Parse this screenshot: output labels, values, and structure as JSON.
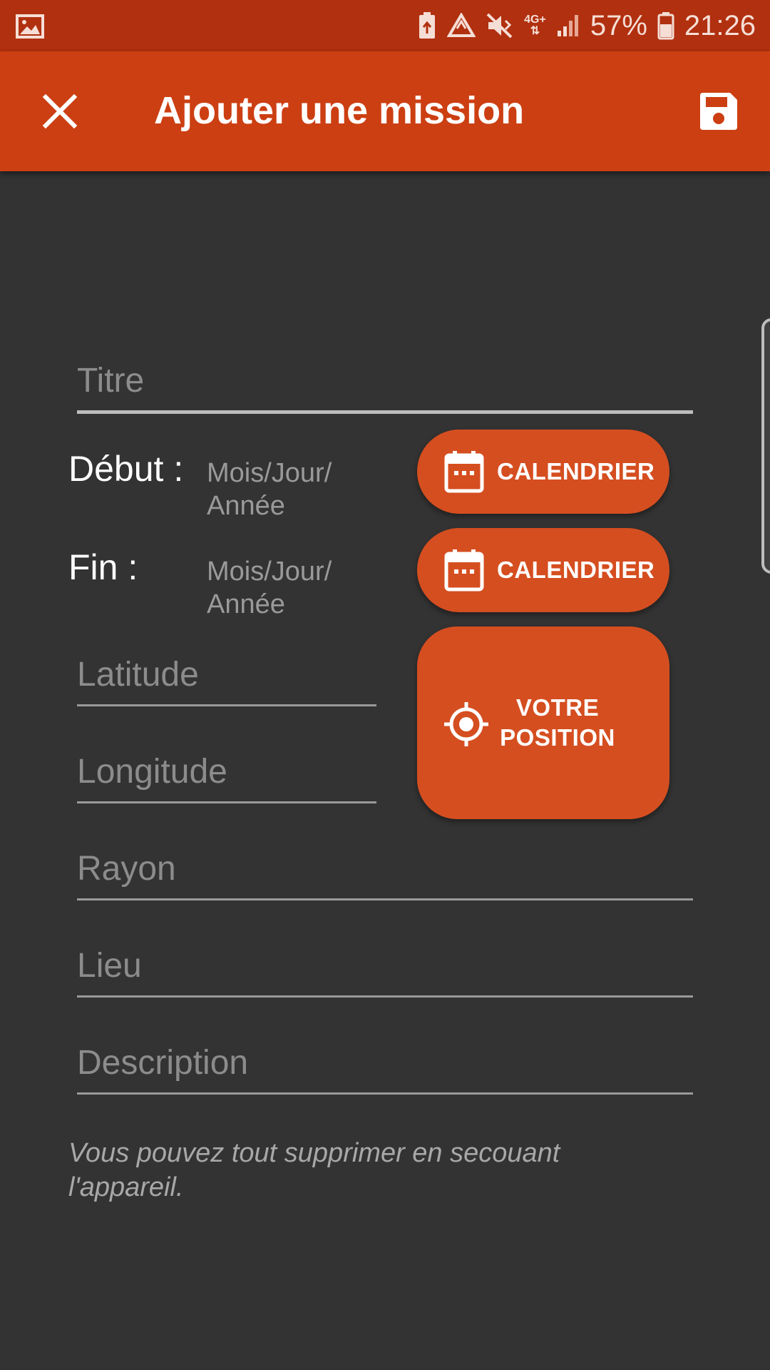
{
  "status_bar": {
    "network": "4G+",
    "battery": "57%",
    "time": "21:26"
  },
  "app_bar": {
    "title": "Ajouter une mission",
    "close_icon": "close-icon",
    "save_icon": "save-icon"
  },
  "form": {
    "titre_placeholder": "Titre",
    "debut_label": "Début :",
    "debut_placeholder_line1": "Mois/Jour/",
    "debut_placeholder_line2": "Année",
    "fin_label": "Fin :",
    "fin_placeholder_line1": "Mois/Jour/",
    "fin_placeholder_line2": "Année",
    "calendar_button": "CALENDRIER",
    "latitude_placeholder": "Latitude",
    "longitude_placeholder": "Longitude",
    "position_button_line1": "VOTRE",
    "position_button_line2": "POSITION",
    "rayon_placeholder": "Rayon",
    "lieu_placeholder": "Lieu",
    "description_placeholder": "Description"
  },
  "hint": "Vous pouvez tout supprimer en secouant l'appareil.",
  "colors": {
    "status_bar": "#b1300f",
    "app_bar": "#cc3f12",
    "button": "#d54e20",
    "background": "#333333"
  }
}
